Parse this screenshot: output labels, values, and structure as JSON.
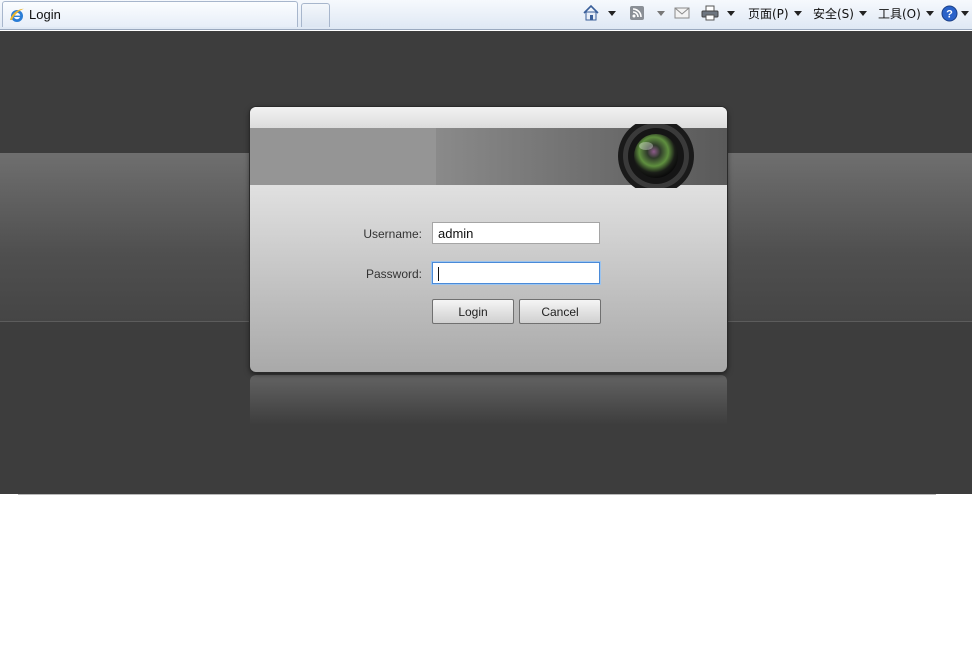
{
  "browser": {
    "tab_title": "Login",
    "toolbar": {
      "home_icon": "home-icon",
      "feeds_icon": "rss-icon",
      "mail_icon": "mail-icon",
      "print_icon": "print-icon",
      "page_menu": "页面(P)",
      "safety_menu": "安全(S)",
      "tools_menu": "工具(O)",
      "help_icon": "help-icon"
    }
  },
  "login": {
    "username_label": "Username:",
    "username_value": "admin",
    "password_label": "Password:",
    "password_value": "",
    "login_button": "Login",
    "cancel_button": "Cancel"
  },
  "colors": {
    "page_background": "#3d3d3d",
    "focus_accent": "#4a8ad8"
  }
}
